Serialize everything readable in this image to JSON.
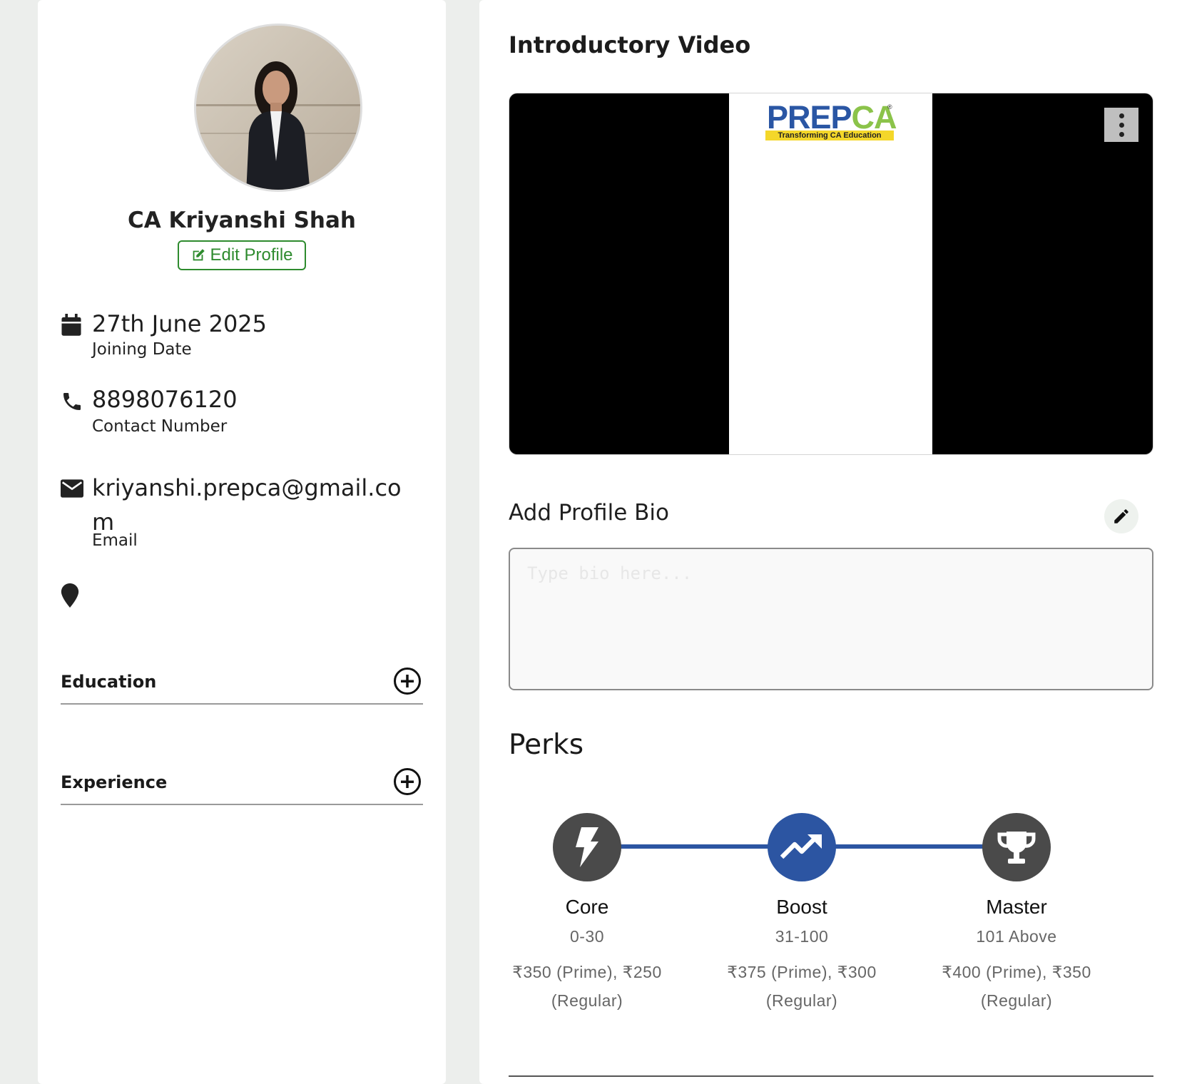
{
  "colors": {
    "accent_green": "#2e8b2e",
    "perk_blue": "#2c55a2",
    "perk_gray": "#4a4a4a",
    "page_bg": "#eceeec"
  },
  "profile": {
    "name": "CA Kriyanshi Shah",
    "edit_label": "Edit Profile",
    "edit_icon": "edit-square-icon",
    "photo": "profile-photo"
  },
  "info": {
    "joining": {
      "icon": "calendar-icon",
      "value": "27th June 2025",
      "label": "Joining Date"
    },
    "phone": {
      "icon": "phone-icon",
      "value": "8898076120",
      "label": "Contact Number"
    },
    "email": {
      "icon": "envelope-icon",
      "value": "kriyanshi.prepca@gmail.co",
      "value_wrap": "m",
      "label": "Email"
    },
    "location": {
      "icon": "map-pin-icon",
      "value": ""
    }
  },
  "sections": {
    "education": {
      "title": "Education",
      "icon": "plus-circle-icon"
    },
    "experience": {
      "title": "Experience",
      "icon": "plus-circle-icon"
    }
  },
  "video": {
    "title": "Introductory Video",
    "logo_main": "PREP",
    "logo_accent": "CA",
    "logo_reg": "®",
    "logo_tagline": "Transforming CA Education",
    "menu_icon": "more-vertical-icon"
  },
  "bio": {
    "label": "Add Profile Bio",
    "edit_icon": "pencil-icon",
    "placeholder": "Type bio here...",
    "value": ""
  },
  "perks": {
    "title": "Perks",
    "items": [
      {
        "name": "Core",
        "range": "0-30",
        "price_line1": "₹350 (Prime), ₹250",
        "price_line2": "(Regular)",
        "icon": "lightning-bolt-icon",
        "color": "#4a4a4a"
      },
      {
        "name": "Boost",
        "range": "31-100",
        "price_line1": "₹375 (Prime), ₹300",
        "price_line2": "(Regular)",
        "icon": "trending-up-icon",
        "color": "#2c55a2"
      },
      {
        "name": "Master",
        "range": "101 Above",
        "price_line1": "₹400 (Prime), ₹350",
        "price_line2": "(Regular)",
        "icon": "trophy-icon",
        "color": "#4a4a4a"
      }
    ]
  }
}
